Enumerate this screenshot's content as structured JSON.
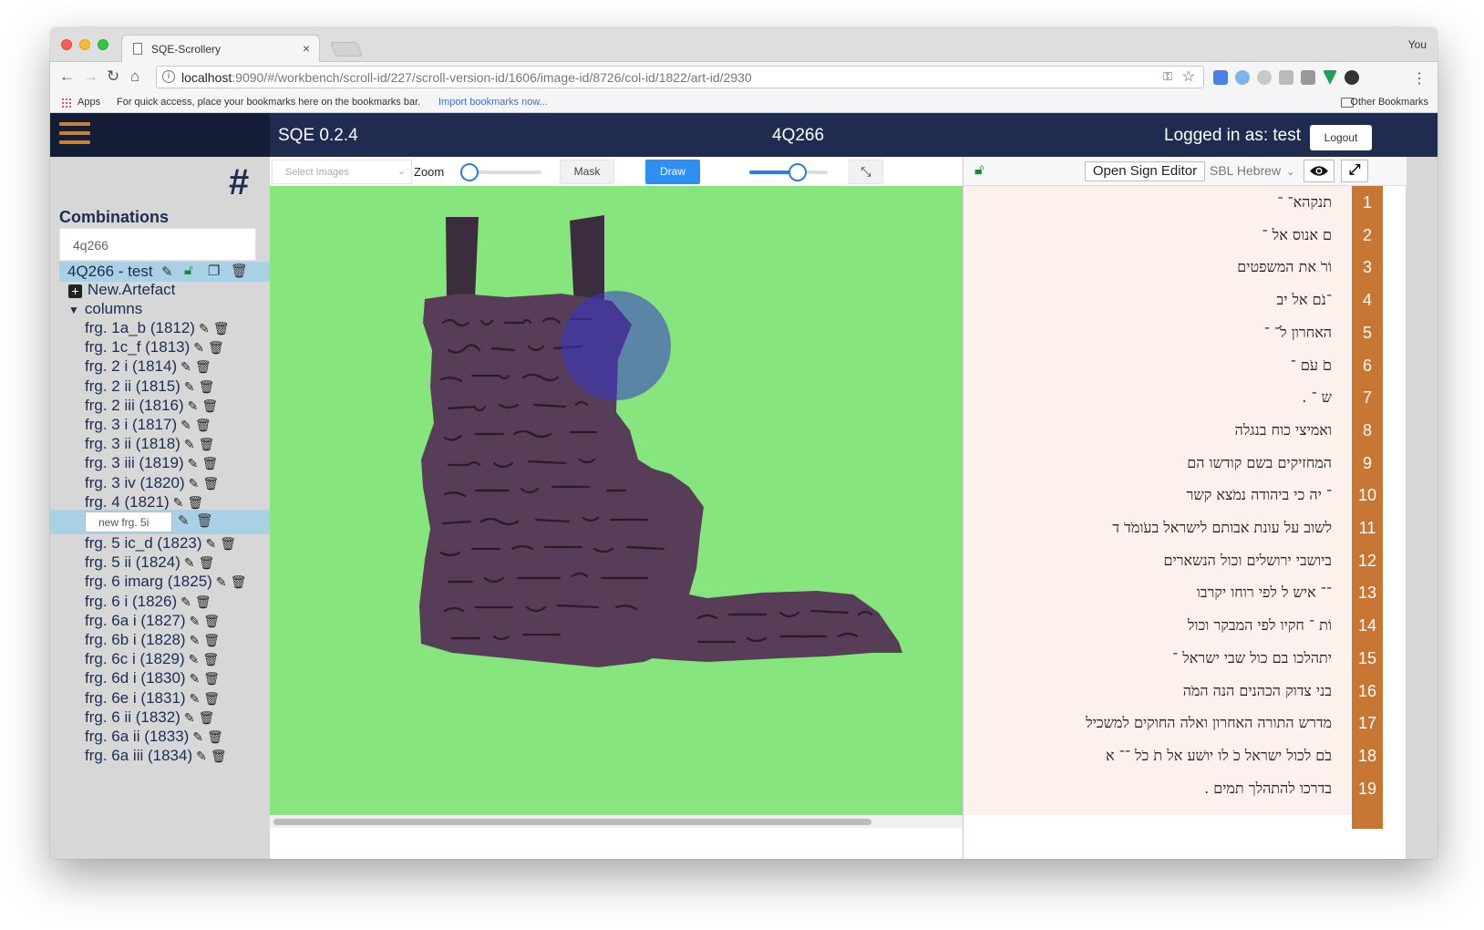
{
  "browser": {
    "tab_title": "SQE-Scrollery",
    "profile": "You",
    "url_host": "localhost",
    "url_rest": ":9090/#/workbench/scroll-id/227/scroll-version-id/1606/image-id/8726/col-id/1822/art-id/2930",
    "bookmarks_apps": "Apps",
    "bookmarks_hint": "For quick access, place your bookmarks here on the bookmarks bar.",
    "bookmarks_import": "Import bookmarks now...",
    "bookmarks_other": "Other Bookmarks"
  },
  "header": {
    "version": "SQE 0.2.4",
    "scroll_title": "4Q266",
    "logged_in": "Logged in as: test",
    "logout": "Logout"
  },
  "sidebar": {
    "hash_icon": "#",
    "combinations_heading": "Combinations",
    "search_value": "4q266",
    "combination": "4Q266 - test",
    "new_artefact": "New.Artefact",
    "columns_label": "columns",
    "fragments": [
      "frg. 1a_b (1812)",
      "frg. 1c_f (1813)",
      "frg. 2 i (1814)",
      "frg. 2 ii (1815)",
      "frg. 2 iii (1816)",
      "frg. 3 i (1817)",
      "frg. 3 ii (1818)",
      "frg. 3 iii (1819)",
      "frg. 3 iv (1820)",
      "frg. 4 (1821)"
    ],
    "editing_fragment": "new frg. 5i",
    "fragments_after": [
      "frg. 5 ic_d (1823)",
      "frg. 5 ii (1824)",
      "frg. 6 imarg (1825)",
      "frg. 6 i (1826)",
      "frg. 6a i (1827)",
      "frg. 6b i (1828)",
      "frg. 6c i (1829)",
      "frg. 6d i (1830)",
      "frg. 6e i (1831)",
      "frg. 6 ii (1832)",
      "frg. 6a ii (1833)",
      "frg. 6a iii (1834)"
    ]
  },
  "image_toolbar": {
    "select_images_placeholder": "Select Images",
    "zoom_label": "Zoom",
    "zoom_level": 0.1,
    "mask_button": "Mask",
    "draw_button": "Draw",
    "brush_level": 0.62,
    "fullscreen_icon": "compress-icon"
  },
  "text_toolbar": {
    "lock_icon": "unlock-icon",
    "open_sign_editor": "Open Sign Editor",
    "font": "SBL Hebrew",
    "eye_icon": "eye-icon",
    "expand_icon": "expand-icon"
  },
  "transcription": [
    {
      "num": "1",
      "text": "תנקהא־ ־"
    },
    {
      "num": "2",
      "text": "ם אנוס אל ־"
    },
    {
      "num": "3",
      "text": "וֹרֹ את המשפטים"
    },
    {
      "num": "4",
      "text": "־נֹם   אל יב"
    },
    {
      "num": "5",
      "text": "האחרון לֹ־ ־"
    },
    {
      "num": "6",
      "text": "םֹ עֹם ־"
    },
    {
      "num": "7",
      "text": "ש ־  ."
    },
    {
      "num": "8",
      "text": "ואמיצי כוח בנגלה"
    },
    {
      "num": "9",
      "text": "המחזיקים בשם קודשו הם"
    },
    {
      "num": "10",
      "text": "־ יה כי ביהודה נמֹצא קשר"
    },
    {
      "num": "11",
      "text": "לשוב על עונת אבותם   לישראל בעֹומֹדֹ ד"
    },
    {
      "num": "12",
      "text": "ביושבי ירושלים   וכול הנשארים"
    },
    {
      "num": "13",
      "text": "־־ איש ל לפי רוחו יקרבו"
    },
    {
      "num": "14",
      "text": "וֹת ־ חקיו לפי המבקר וכול"
    },
    {
      "num": "15",
      "text": "יתהלכו בם   כול שבי ישראל ־"
    },
    {
      "num": "16",
      "text": "בני צדוק הכהנים הנה המֹה"
    },
    {
      "num": "17",
      "text": "מדרש התורה האחרון   ואלה החוקים למשכיל"
    },
    {
      "num": "18",
      "text": "בֹם לכול ישראל כֹ לו יושׁע אל   תֹ כֹל ־־ א"
    },
    {
      "num": "19",
      "text": "בדרכו להתהלך תמים  ."
    }
  ],
  "colors": {
    "topbar": "#1f2c50",
    "accent_orange": "#c87634",
    "canvas_green": "#86e57d",
    "fragment": "#5a3f5a",
    "draw_blue": "#2d8ef3"
  }
}
